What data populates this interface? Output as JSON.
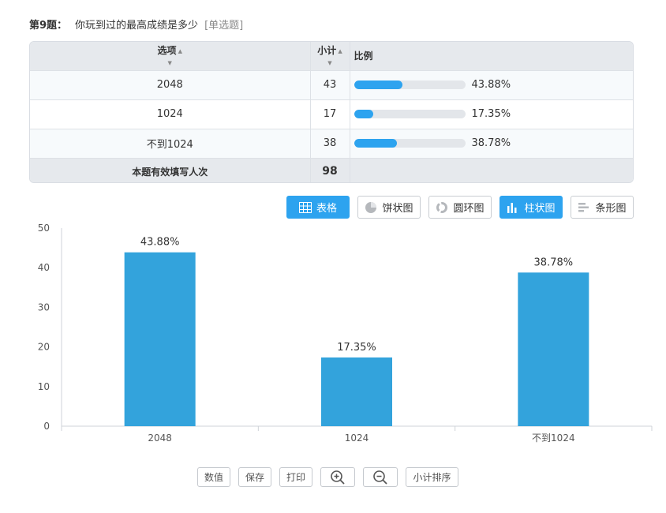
{
  "question": {
    "number_label": "第9题：",
    "text": "你玩到过的最高成绩是多少",
    "type": "[单选题]"
  },
  "table": {
    "headers": {
      "option": "选项",
      "count": "小计",
      "ratio": "比例"
    },
    "sort_icon": "sort-icon",
    "rows": [
      {
        "option": "2048",
        "count": "43",
        "percent": "43.88%",
        "fraction": 0.4388
      },
      {
        "option": "1024",
        "count": "17",
        "percent": "17.35%",
        "fraction": 0.1735
      },
      {
        "option": "不到1024",
        "count": "38",
        "percent": "38.78%",
        "fraction": 0.3878
      }
    ],
    "total_label": "本题有效填写人次",
    "total": "98"
  },
  "view_buttons": {
    "table": "表格",
    "pie": "饼状图",
    "ring": "圆环图",
    "column": "柱状图",
    "bar": "条形图",
    "active": [
      "table",
      "column"
    ]
  },
  "chart_data": {
    "type": "bar",
    "categories": [
      "2048",
      "1024",
      "不到1024"
    ],
    "values": [
      43.88,
      17.35,
      38.78
    ],
    "data_labels": [
      "43.88%",
      "17.35%",
      "38.78%"
    ],
    "ylim": [
      0,
      50
    ],
    "yticks": [
      "0",
      "10",
      "20",
      "30",
      "40",
      "50"
    ],
    "title": "",
    "xlabel": "",
    "ylabel": "",
    "bar_color": "#33a3dc",
    "grid": false
  },
  "toolbar": {
    "values": "数值",
    "save": "保存",
    "print": "打印",
    "zoom_in_icon": "zoom-in-icon",
    "zoom_out_icon": "zoom-out-icon",
    "sort_by_count": "小计排序"
  },
  "colors": {
    "accent": "#2da3ef",
    "header_bg": "#e6e9ed",
    "track": "#e3e6ea"
  }
}
